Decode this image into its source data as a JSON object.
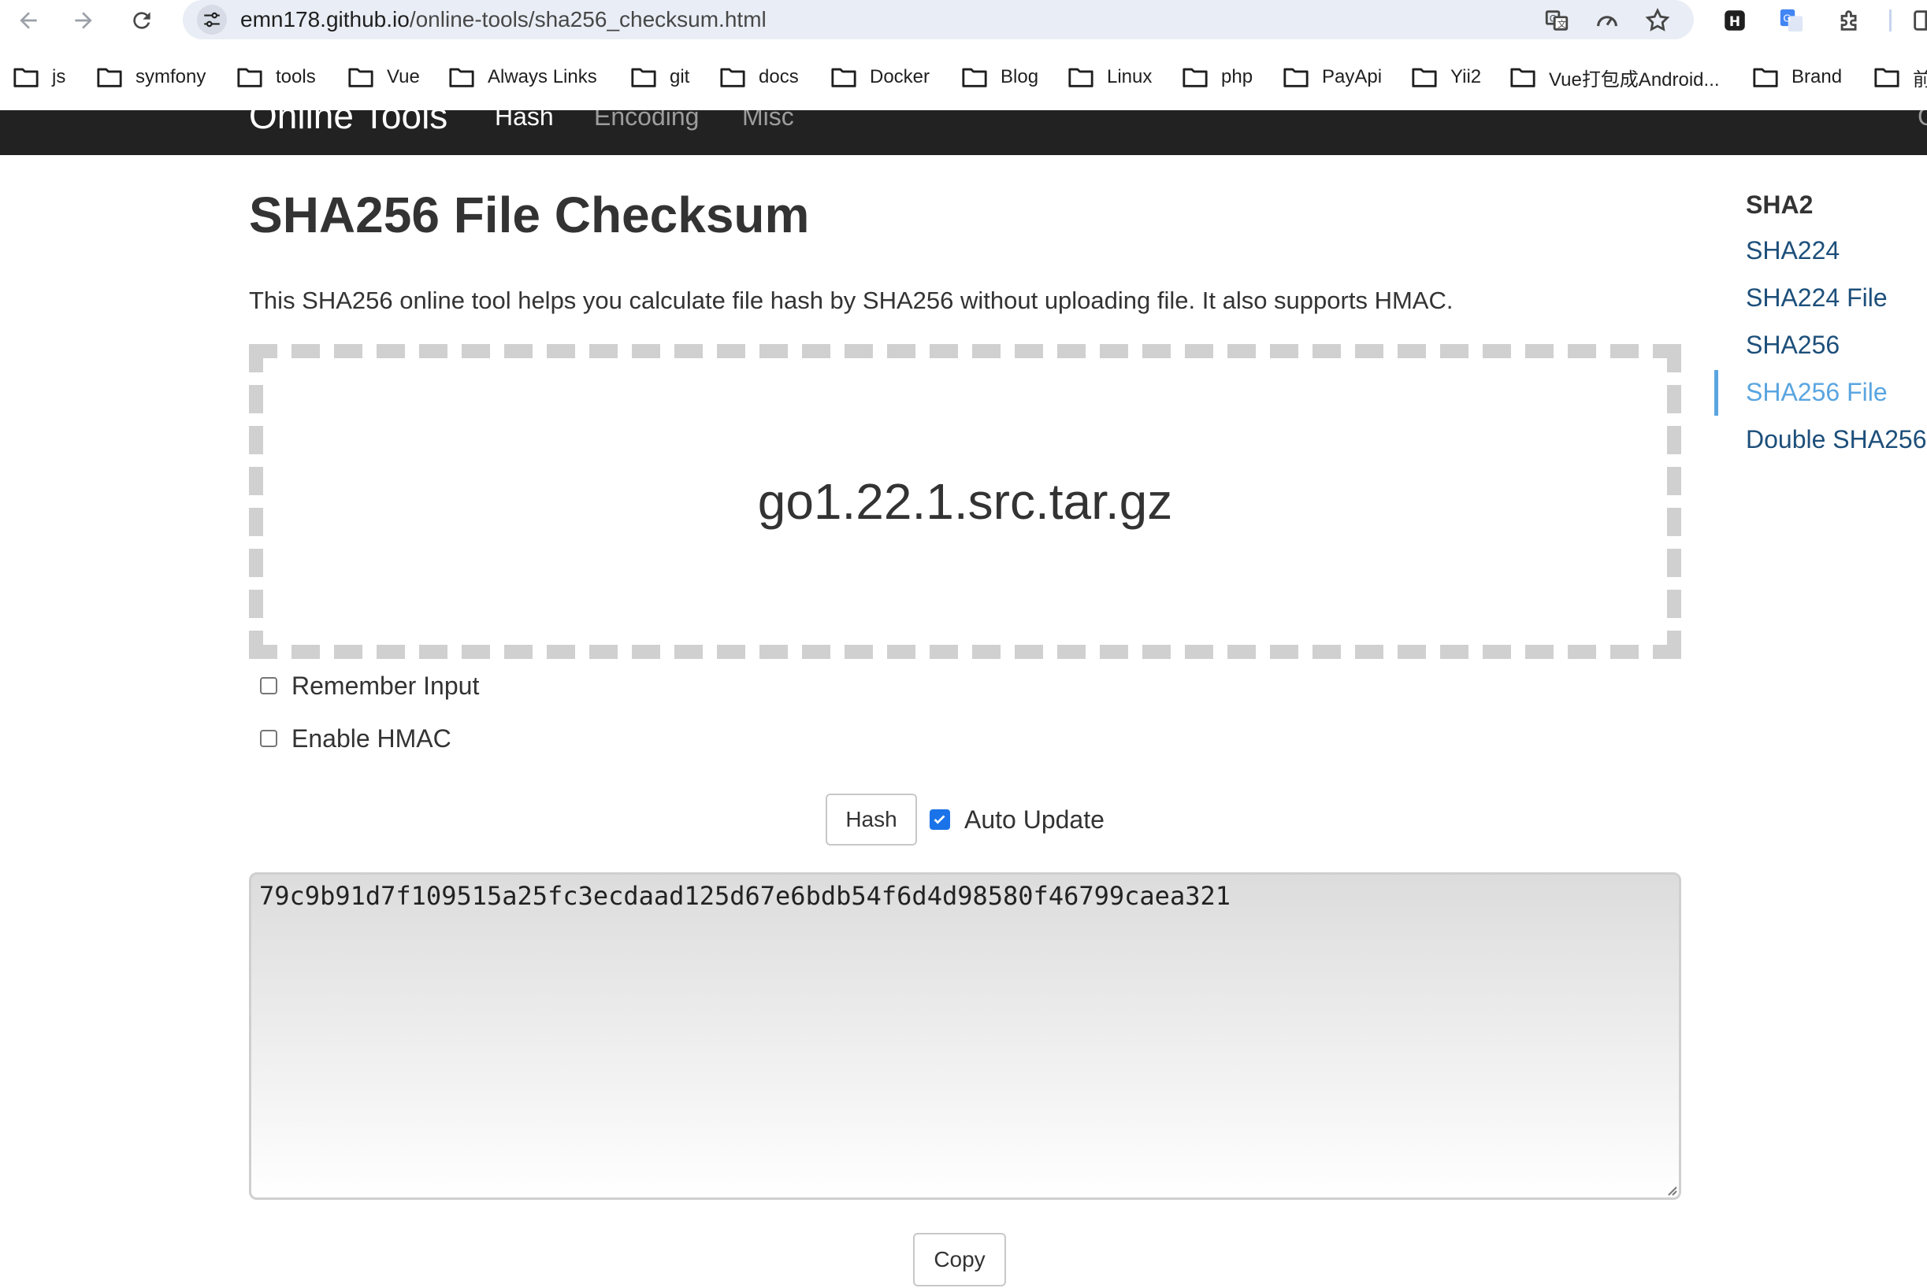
{
  "browser": {
    "url_host": "emn178.github.io",
    "url_path": "/online-tools/sha256_checksum.html",
    "bookmarks": [
      "js",
      "symfony",
      "tools",
      "Vue",
      "Always Links",
      "git",
      "docs",
      "Docker",
      "Blog",
      "Linux",
      "php",
      "PayApi",
      "Yii2",
      "Vue打包成Android...",
      "Brand",
      "前"
    ],
    "icons": [
      "back-icon",
      "forward-icon",
      "reload-icon",
      "site-info-icon",
      "translate-icon",
      "speedometer-icon",
      "star-icon",
      "extension-h-icon",
      "google-translate-icon",
      "puzzle-icon",
      "sidebar-icon"
    ]
  },
  "navbar": {
    "brand": "Online Tools",
    "links": [
      {
        "label": "Hash",
        "active": true
      },
      {
        "label": "Encoding",
        "active": false
      },
      {
        "label": "Misc",
        "active": false
      }
    ],
    "right_edge_fragment": "G"
  },
  "main": {
    "title": "SHA256 File Checksum",
    "description": "This SHA256 online tool helps you calculate file hash by SHA256 without uploading file. It also supports HMAC.",
    "file_name": "go1.22.1.src.tar.gz",
    "remember_input_label": "Remember Input",
    "remember_input_checked": false,
    "enable_hmac_label": "Enable HMAC",
    "enable_hmac_checked": false,
    "hash_button_label": "Hash",
    "auto_update_label": "Auto Update",
    "auto_update_checked": true,
    "output": "79c9b91d7f109515a25fc3ecdaad125d67e6bdb54f6d4d98580f46799caea321",
    "copy_button_label": "Copy"
  },
  "sidebar": {
    "header": "SHA2",
    "items": [
      {
        "label": "SHA224",
        "active": false
      },
      {
        "label": "SHA224 File",
        "active": false
      },
      {
        "label": "SHA256",
        "active": false
      },
      {
        "label": "SHA256 File",
        "active": true
      },
      {
        "label": "Double SHA256",
        "active": false
      }
    ]
  },
  "colors": {
    "navbar_bg": "#222222",
    "link": "#1d4f7a",
    "active_link": "#5aa5e0",
    "checkbox_checked": "#1a73e8"
  }
}
